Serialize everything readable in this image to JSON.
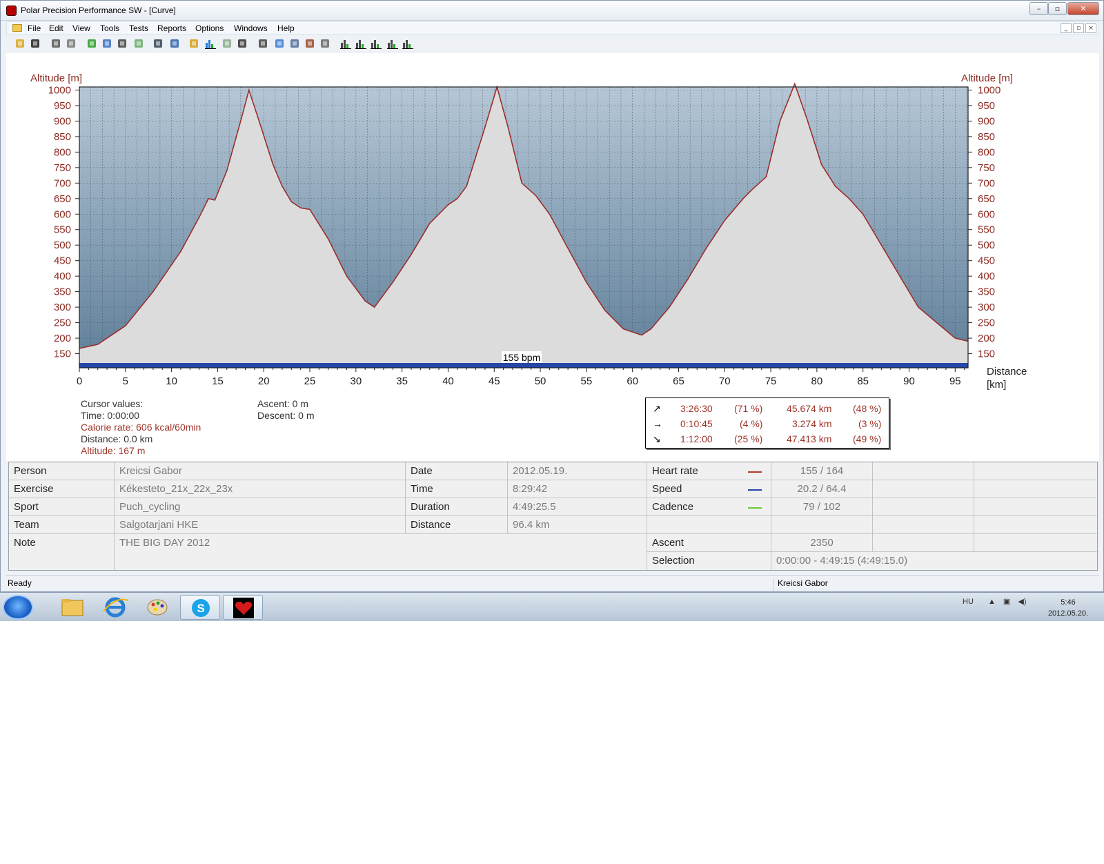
{
  "window": {
    "title": "Polar Precision Performance SW - [Curve]"
  },
  "menu": {
    "items": [
      "File",
      "Edit",
      "View",
      "Tools",
      "Tests",
      "Reports",
      "Options",
      "Windows",
      "Help"
    ]
  },
  "toolbar": {
    "icons": [
      "open-icon",
      "save-icon",
      "print-icon",
      "copy-icon",
      "refresh-icon",
      "globe-icon",
      "sound-icon",
      "tool-icon",
      "table-icon",
      "book-icon",
      "line-chart-icon",
      "bar-chart-icon",
      "percent-chart-icon",
      "grid-icon",
      "zoom-icon",
      "curve-zoom-icon",
      "zoom-out-icon",
      "swap-icon",
      "compare-icon",
      "bar1-icon",
      "bar2-icon",
      "bar3-icon",
      "bar4-icon",
      "bar5-icon"
    ]
  },
  "chart_data": {
    "type": "area",
    "ylabel_left": "Altitude [m]",
    "ylabel_right": "Altitude [m]",
    "xlabel": "Distance [km]",
    "xlabel_lines": [
      "Distance",
      "[km]"
    ],
    "xlim": [
      0,
      96.4
    ],
    "ylim": [
      120,
      1010
    ],
    "y_ticks": [
      1000,
      950,
      900,
      850,
      800,
      750,
      700,
      650,
      600,
      550,
      500,
      450,
      400,
      350,
      300,
      250,
      200,
      150
    ],
    "x_ticks": [
      0,
      5,
      10,
      15,
      20,
      25,
      30,
      35,
      40,
      45,
      50,
      55,
      60,
      65,
      70,
      75,
      80,
      85,
      90,
      95
    ],
    "series": [
      {
        "name": "Altitude",
        "color": "#9a2e2e",
        "points": [
          [
            0,
            167
          ],
          [
            2,
            180
          ],
          [
            5,
            240
          ],
          [
            8,
            350
          ],
          [
            11,
            480
          ],
          [
            13,
            590
          ],
          [
            14,
            650
          ],
          [
            14.7,
            645
          ],
          [
            16,
            740
          ],
          [
            17.5,
            900
          ],
          [
            18.4,
            1000
          ],
          [
            19.5,
            900
          ],
          [
            21,
            760
          ],
          [
            22,
            690
          ],
          [
            23,
            640
          ],
          [
            24,
            620
          ],
          [
            25,
            615
          ],
          [
            27,
            520
          ],
          [
            29,
            400
          ],
          [
            31,
            320
          ],
          [
            32,
            300
          ],
          [
            34,
            380
          ],
          [
            36,
            470
          ],
          [
            38,
            570
          ],
          [
            40,
            630
          ],
          [
            41,
            650
          ],
          [
            42,
            690
          ],
          [
            44,
            880
          ],
          [
            45.3,
            1010
          ],
          [
            46.5,
            880
          ],
          [
            48,
            700
          ],
          [
            49.5,
            660
          ],
          [
            51,
            600
          ],
          [
            53,
            490
          ],
          [
            55,
            380
          ],
          [
            57,
            290
          ],
          [
            59,
            230
          ],
          [
            61,
            210
          ],
          [
            62,
            230
          ],
          [
            64,
            300
          ],
          [
            66,
            390
          ],
          [
            68,
            490
          ],
          [
            70,
            580
          ],
          [
            72,
            650
          ],
          [
            73,
            680
          ],
          [
            74.5,
            720
          ],
          [
            76,
            900
          ],
          [
            77.6,
            1020
          ],
          [
            79,
            900
          ],
          [
            80.5,
            760
          ],
          [
            82,
            690
          ],
          [
            83.5,
            650
          ],
          [
            85,
            600
          ],
          [
            87,
            500
          ],
          [
            89,
            400
          ],
          [
            91,
            300
          ],
          [
            93,
            250
          ],
          [
            95,
            200
          ],
          [
            96.4,
            190
          ]
        ]
      }
    ],
    "bottom_bar_label": "155 bpm",
    "grid": true,
    "colors": {
      "fill_under": "#dcdcdc",
      "sky_top": "#b6c7d6",
      "sky_bottom": "#5f7f99",
      "line": "#9a2e2e",
      "hr_bar": "#2447a8"
    }
  },
  "cursor": {
    "heading": "Cursor values:",
    "time": "Time: 0:00:00",
    "calorie": "Calorie rate: 606 kcal/60min",
    "distance": "Distance: 0.0 km",
    "altitude": "Altitude: 167 m",
    "ascent": "Ascent: 0 m",
    "descent": "Descent: 0 m"
  },
  "splits": [
    {
      "icon": "↗",
      "time": "3:26:30",
      "time_pct": "(71 %)",
      "dist": "45.674 km",
      "dist_pct": "(48 %)"
    },
    {
      "icon": "→",
      "time": "0:10:45",
      "time_pct": "(4 %)",
      "dist": "3.274 km",
      "dist_pct": "(3 %)"
    },
    {
      "icon": "↘",
      "time": "1:12:00",
      "time_pct": "(25 %)",
      "dist": "47.413 km",
      "dist_pct": "(49 %)"
    }
  ],
  "info": {
    "person_label": "Person",
    "person": "Kreicsi Gabor",
    "exercise_label": "Exercise",
    "exercise": "Kékesteto_21x_22x_23x",
    "sport_label": "Sport",
    "sport": "Puch_cycling",
    "team_label": "Team",
    "team": "Salgotarjani HKE",
    "note_label": "Note",
    "note": "THE BIG DAY 2012",
    "date_label": "Date",
    "date": "2012.05.19.",
    "time_label": "Time",
    "time": "8:29:42",
    "duration_label": "Duration",
    "duration": "4:49:25.5",
    "distance_label": "Distance",
    "distance": "96.4 km",
    "hr_label": "Heart rate",
    "hr": "155 / 164",
    "speed_label": "Speed",
    "speed": "20.2 / 64.4",
    "cadence_label": "Cadence",
    "cadence": "79 / 102",
    "ascent_label": "Ascent",
    "ascent": "2350",
    "selection_label": "Selection",
    "selection": "0:00:00 - 4:49:15 (4:49:15.0)"
  },
  "status": {
    "left": "Ready",
    "right": "Kreicsi Gabor"
  },
  "taskbar": {
    "lang": "HU",
    "time": "5:46",
    "date": "2012.05.20."
  }
}
